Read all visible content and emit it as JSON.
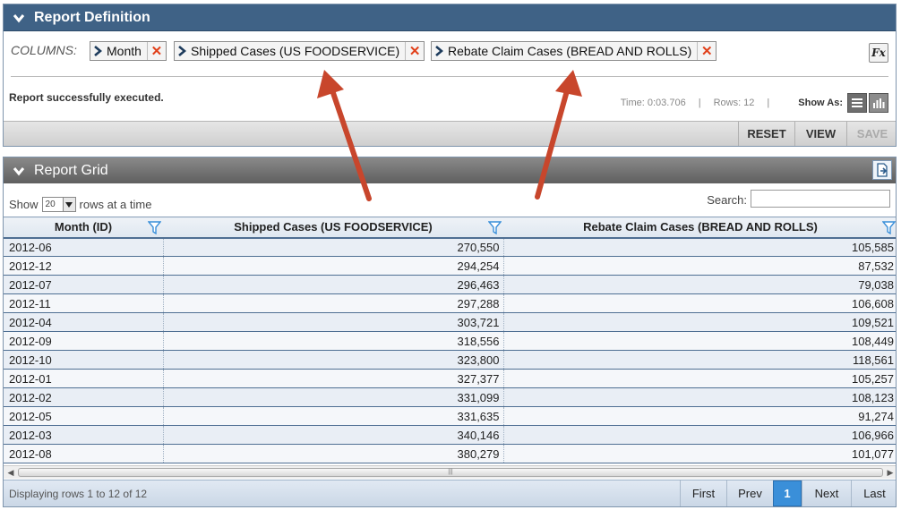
{
  "definition": {
    "title": "Report Definition",
    "columns_label": "COLUMNS:",
    "chips": [
      {
        "label": "Month"
      },
      {
        "label": "Shipped Cases (US FOODSERVICE)"
      },
      {
        "label": "Rebate Claim Cases (BREAD AND ROLLS)"
      }
    ],
    "fx_label": "Fx",
    "status": "Report successfully executed.",
    "time": "Time: 0:03.706",
    "rows": "Rows: 12",
    "show_as": "Show As:",
    "toolbar": {
      "reset": "RESET",
      "view": "VIEW",
      "save": "SAVE"
    }
  },
  "grid": {
    "title": "Report Grid",
    "show_prefix": "Show",
    "page_size": "20",
    "show_suffix": "rows at a time",
    "search_label": "Search:",
    "search_value": "",
    "headers": [
      "Month (ID)",
      "Shipped Cases (US FOODSERVICE)",
      "Rebate Claim Cases (BREAD AND ROLLS)"
    ],
    "rows": [
      [
        "2012-06",
        "270,550",
        "105,585"
      ],
      [
        "2012-12",
        "294,254",
        "87,532"
      ],
      [
        "2012-07",
        "296,463",
        "79,038"
      ],
      [
        "2012-11",
        "297,288",
        "106,608"
      ],
      [
        "2012-04",
        "303,721",
        "109,521"
      ],
      [
        "2012-09",
        "318,556",
        "108,449"
      ],
      [
        "2012-10",
        "323,800",
        "118,561"
      ],
      [
        "2012-01",
        "327,377",
        "105,257"
      ],
      [
        "2012-02",
        "331,099",
        "108,123"
      ],
      [
        "2012-05",
        "331,635",
        "91,274"
      ],
      [
        "2012-03",
        "340,146",
        "106,966"
      ],
      [
        "2012-08",
        "380,279",
        "101,077"
      ]
    ],
    "pager": {
      "info": "Displaying rows 1 to 12 of 12",
      "first": "First",
      "prev": "Prev",
      "current": "1",
      "next": "Next",
      "last": "Last"
    }
  },
  "colors": {
    "header_blue": "#3f6286",
    "remove_x": "#e1401a",
    "annotation_arrow": "#c8462c",
    "pager_current": "#3a8fd9"
  },
  "icons": {
    "collapse": "chevron-down-icon",
    "chip": "chevron-right-icon",
    "remove": "close-icon",
    "filter": "filter-icon",
    "list_view": "list-icon",
    "chart_view": "bar-chart-icon",
    "export": "export-icon"
  }
}
